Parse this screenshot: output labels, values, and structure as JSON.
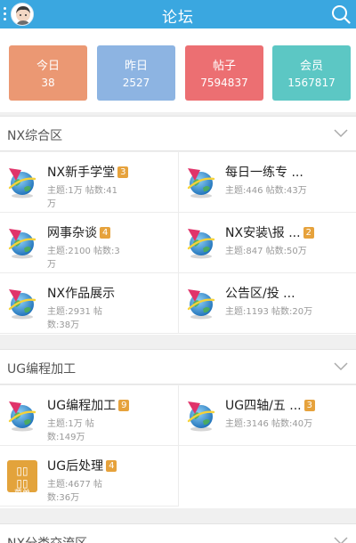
{
  "header": {
    "title": "论坛"
  },
  "stats": [
    {
      "label": "今日",
      "value": "38",
      "color": "#eb9873"
    },
    {
      "label": "昨日",
      "value": "2527",
      "color": "#8db4e2"
    },
    {
      "label": "帖子",
      "value": "7594837",
      "color": "#ec6f72"
    },
    {
      "label": "会员",
      "value": "1567817",
      "color": "#5cc7c4"
    }
  ],
  "sections": [
    {
      "name": "NX综合区",
      "forums": [
        {
          "name": "NX新手学堂",
          "badge": "3",
          "stats": "主题:1万 帖数:41万",
          "icon": "globe-icon"
        },
        {
          "name": "每日一练专 ...",
          "badge": "",
          "stats": "主题:446 帖数:43万",
          "icon": "globe-icon"
        },
        {
          "name": "网事杂谈",
          "badge": "4",
          "stats": "主题:2100 帖数:3万",
          "icon": "globe-icon"
        },
        {
          "name": "NX安装\\报 ...",
          "badge": "2",
          "stats": "主题:847 帖数:50万",
          "icon": "globe-icon"
        },
        {
          "name": "NX作品展示",
          "badge": "",
          "stats": "主题:2931 帖数:38万",
          "icon": "globe-icon"
        },
        {
          "name": "公告区/投 ...",
          "badge": "",
          "stats": "主题:1193 帖数:20万",
          "icon": "globe-icon"
        }
      ]
    },
    {
      "name": "UG编程加工",
      "forums": [
        {
          "name": "UG编程加工",
          "badge": "9",
          "stats": "主题:1万 帖数:149万",
          "icon": "globe-icon"
        },
        {
          "name": "UG四轴/五 ...",
          "badge": "3",
          "stats": "主题:3146 帖数:40万",
          "icon": "globe-icon"
        },
        {
          "name": "UG后处理",
          "badge": "4",
          "stats": "主题:4677 帖数:36万",
          "icon": "menu-icon",
          "icon_text": "菜单"
        }
      ]
    },
    {
      "name": "NX分类交流区"
    }
  ]
}
